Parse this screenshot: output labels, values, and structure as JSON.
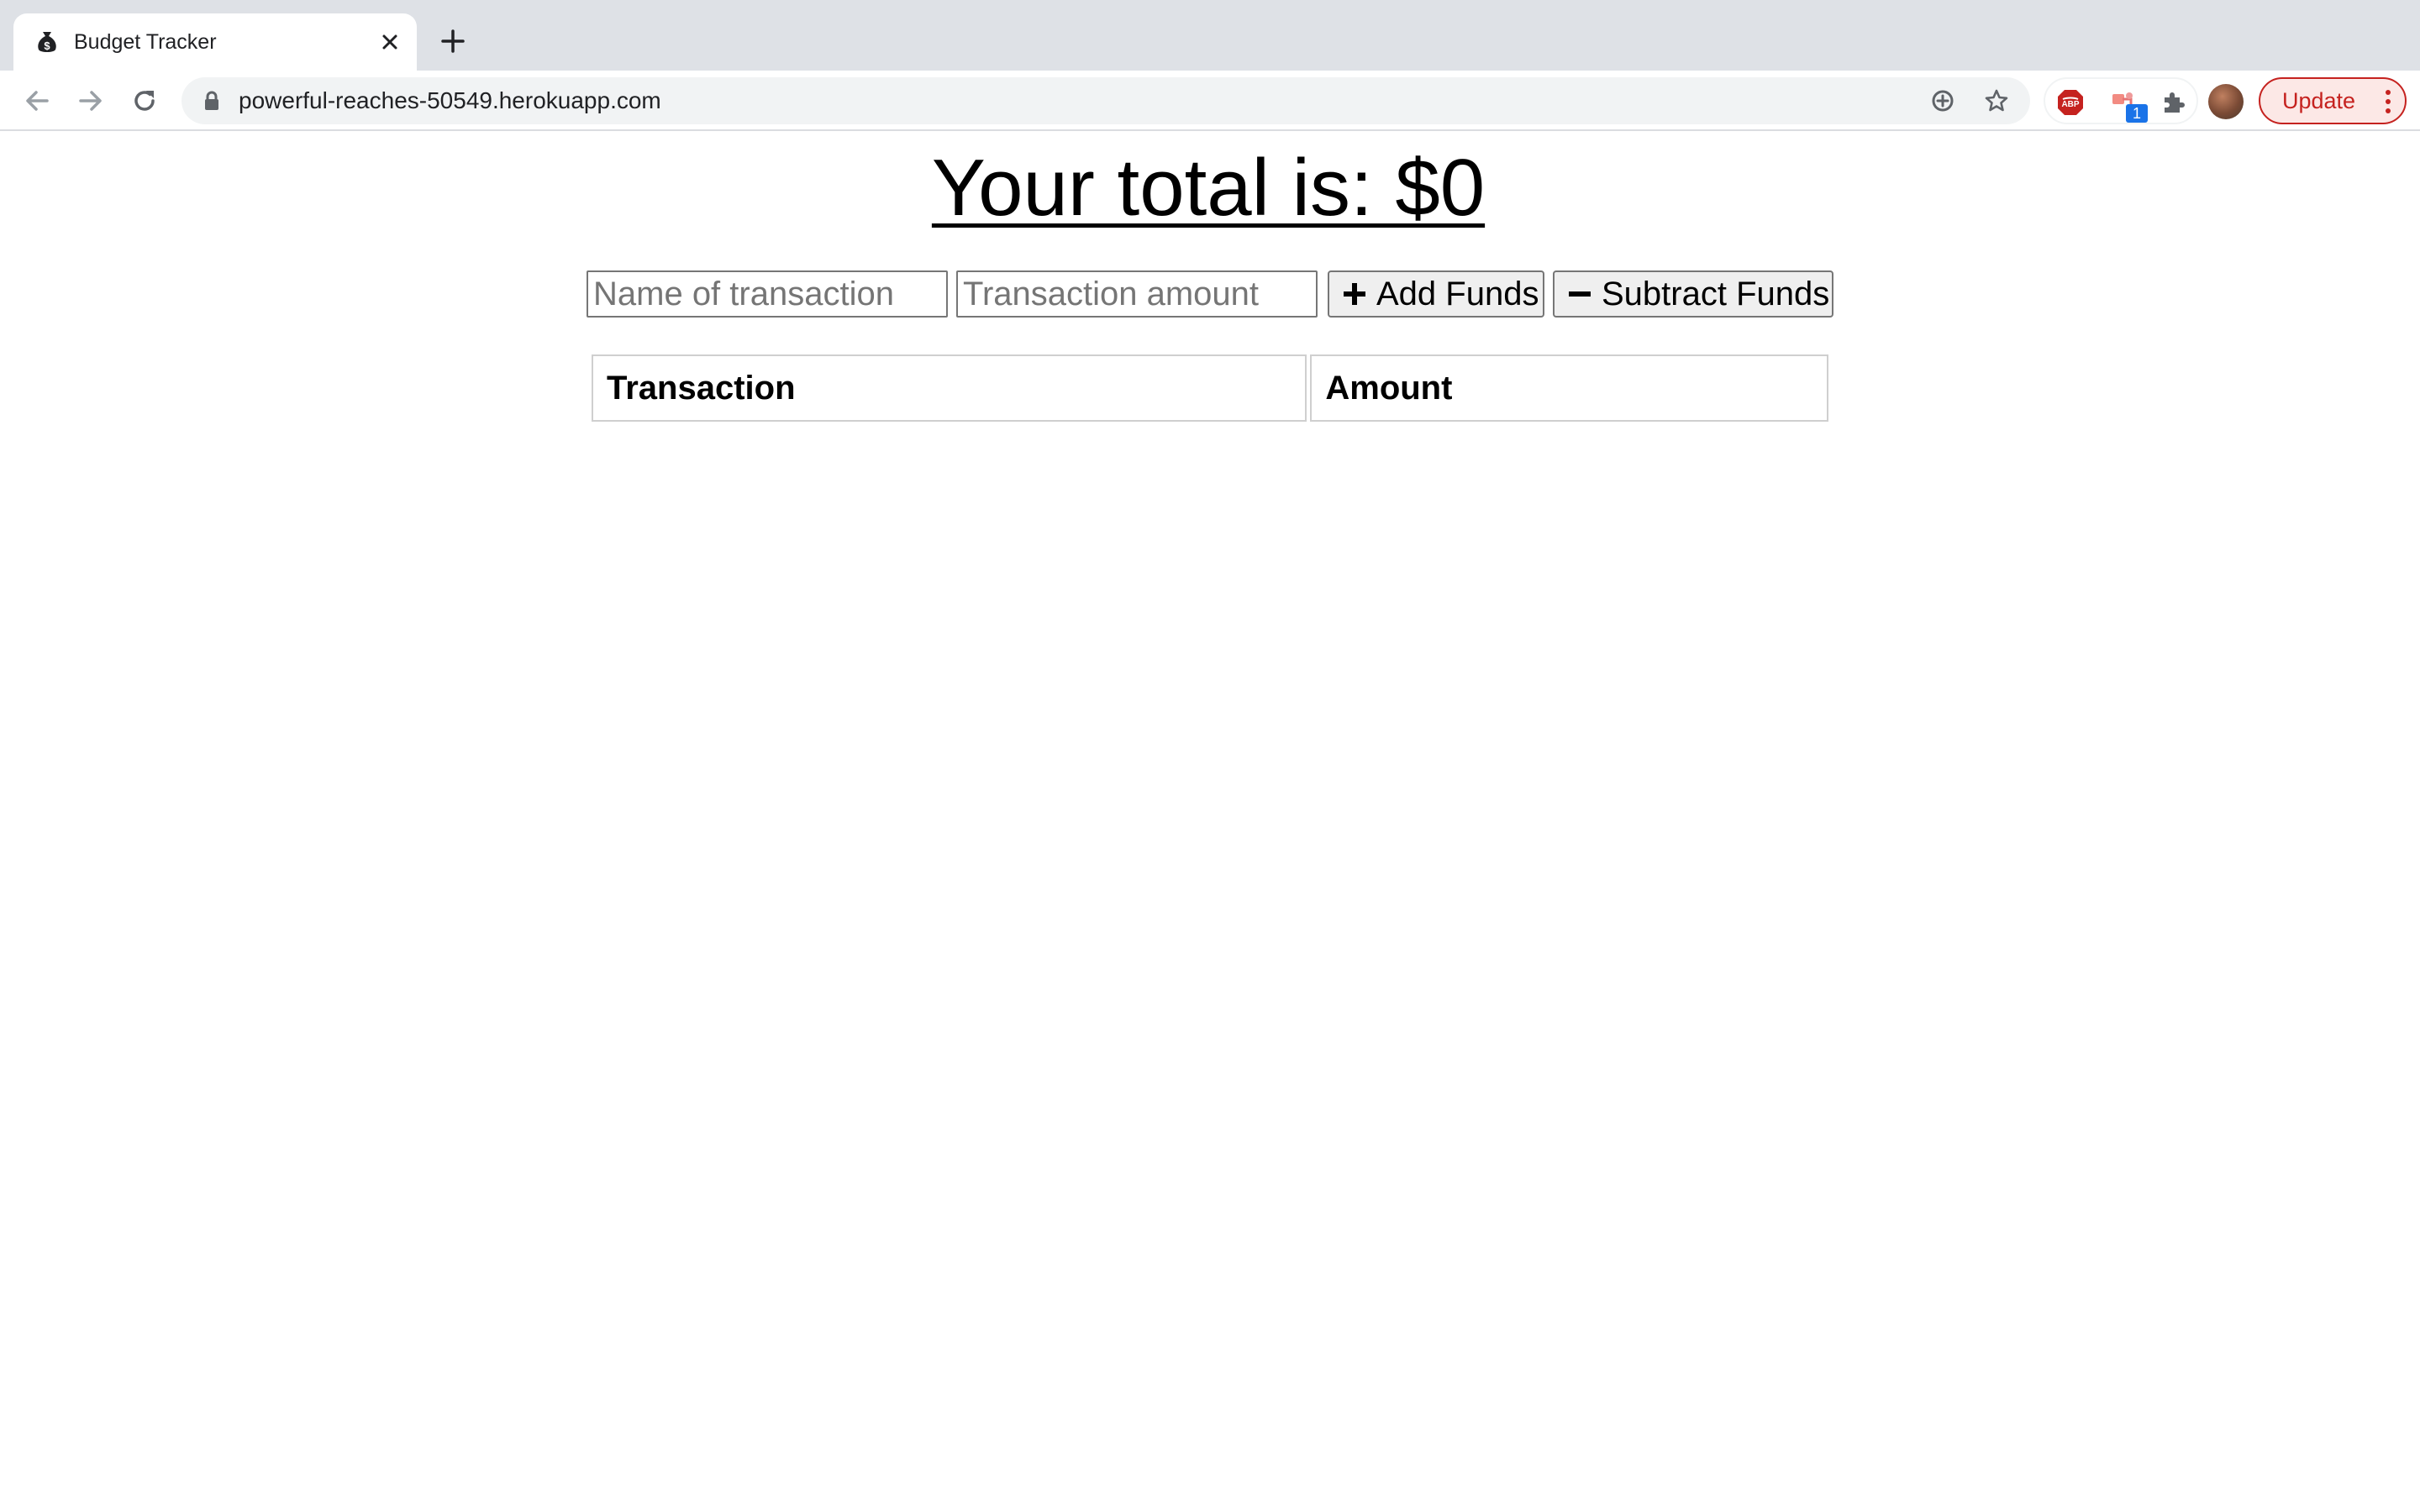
{
  "browser": {
    "tab": {
      "title": "Budget Tracker",
      "favicon": "money-bag-icon"
    },
    "url": "powerful-reaches-50549.herokuapp.com",
    "update_label": "Update",
    "extension_badge": "1",
    "colors": {
      "tabbar": "#dee1e6",
      "update_accent": "#c5221f",
      "badge_blue": "#1a73e8"
    }
  },
  "page": {
    "total_text": "Your total is: $0",
    "name_input": {
      "placeholder": "Name of transaction",
      "value": ""
    },
    "amount_input": {
      "placeholder": "Transaction amount",
      "value": ""
    },
    "add_button": {
      "label": "Add Funds",
      "icon": "plus-icon"
    },
    "subtract_button": {
      "label": "Subtract Funds",
      "icon": "minus-icon"
    },
    "table": {
      "headers": [
        "Transaction",
        "Amount"
      ],
      "rows": []
    }
  }
}
